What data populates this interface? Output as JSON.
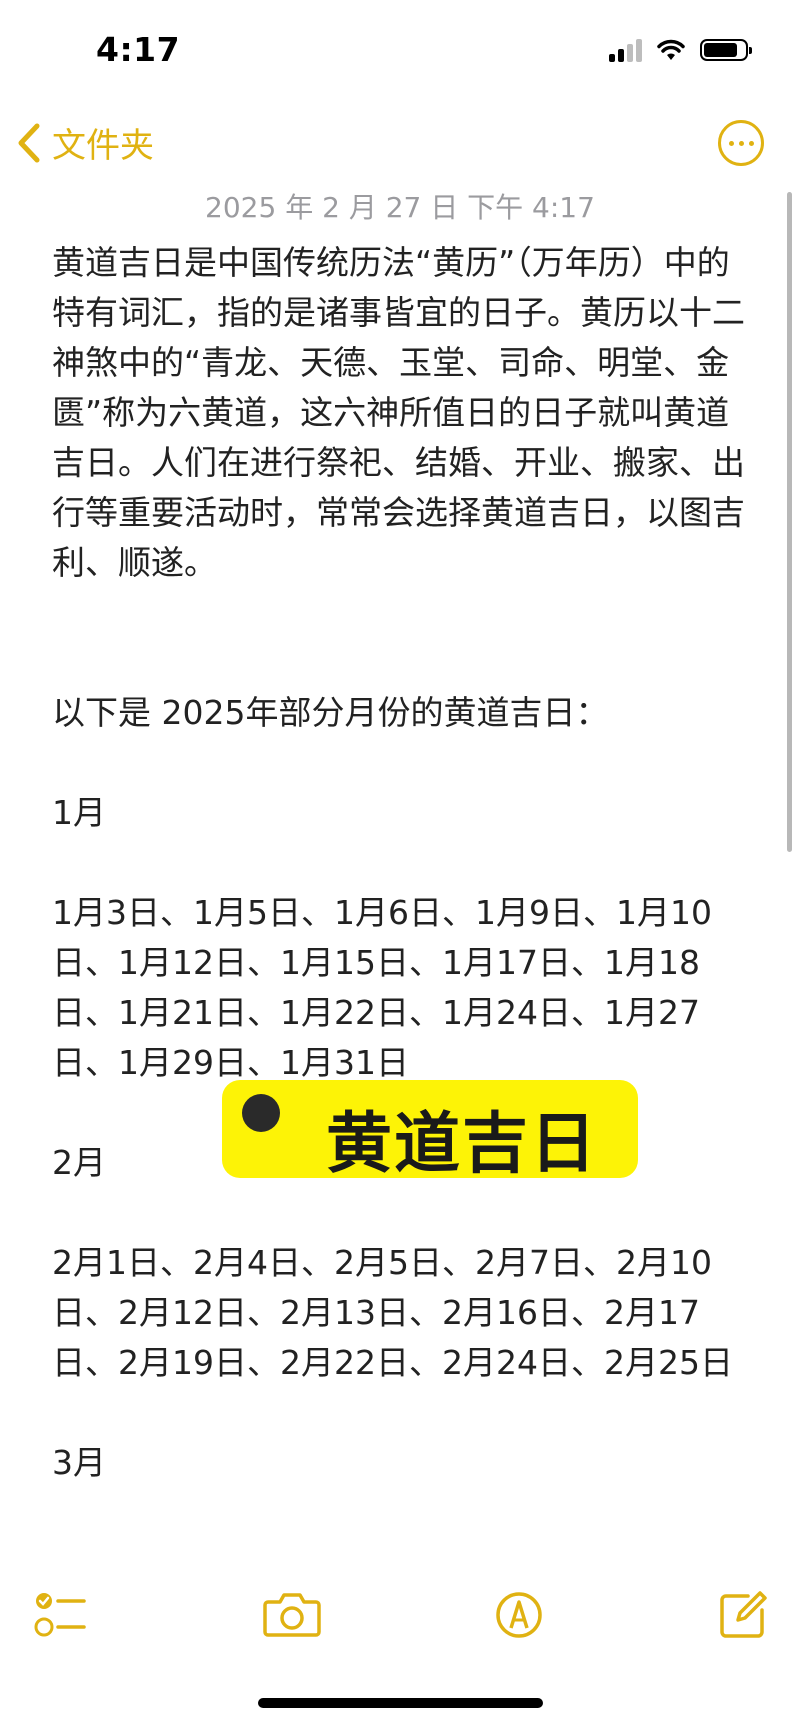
{
  "status_bar": {
    "time": "4:17"
  },
  "nav": {
    "back_label": "文件夹"
  },
  "note": {
    "date": "2025 年 2 月 27 日 下午 4:17",
    "intro": "黄道吉日是中国传统历法“黄历”（万年历）中的特有词汇，指的是诸事皆宜的日子。黄历以十二神煞中的“青龙、天德、玉堂、司命、明堂、金匮”称为六黄道，这六神所值日的日子就叫黄道吉日。人们在进行祭祀、结婚、开业、搬家、出行等重要活动时，常常会选择黄道吉日，以图吉利、顺遂。",
    "list_heading": "以下是 2025年部分月份的黄道吉日：",
    "months": [
      {
        "label": "1月",
        "dates": "1月3日、1月5日、1月6日、1月9日、1月10日、1月12日、1月15日、1月17日、1月18日、1月21日、1月22日、1月24日、1月27日、1月29日、1月31日"
      },
      {
        "label": "2月",
        "dates": "2月1日、2月4日、2月5日、2月7日、2月10日、2月12日、2月13日、2月16日、2月17日、2月19日、2月22日、2月24日、2月25日"
      },
      {
        "label": "3月",
        "dates": ""
      }
    ]
  },
  "sticker": {
    "text": "黄道吉日"
  },
  "colors": {
    "accent": "#e0b212",
    "sticker_bg": "#fdf306"
  },
  "toolbar": {
    "icons": [
      "checklist-icon",
      "camera-icon",
      "markup-icon",
      "compose-icon"
    ]
  }
}
